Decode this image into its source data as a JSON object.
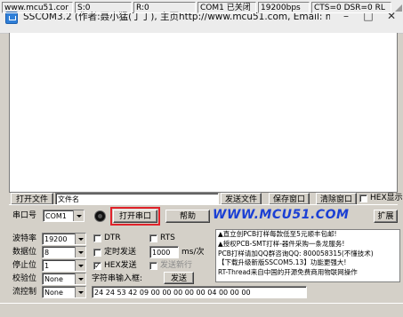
{
  "window": {
    "title": "SSCOM3.2 (作者:聂小猛(丁丁), 主页http://www.mcu51.com,  Email: mc...",
    "minimize_glyph": "–",
    "maximize_glyph": "□",
    "close_glyph": "✕",
    "icon": "app-icon"
  },
  "file_row": {
    "open_file_button": "打开文件",
    "filename_field": "文件名",
    "send_file_button": "发送文件",
    "save_window_button": "保存窗口",
    "clear_window_button": "清除窗口",
    "hex_display_label": "HEX显示",
    "hex_display_checked": false
  },
  "port_row": {
    "port_label": "串口号",
    "port_value": "COM1",
    "open_port_button": "打开串口",
    "help_button": "帮助",
    "logo_text": "WWW.MCU51.COM",
    "expand_button": "扩展"
  },
  "settings": {
    "baud_label": "波特率",
    "baud_value": "19200",
    "databits_label": "数据位",
    "databits_value": "8",
    "stopbits_label": "停止位",
    "stopbits_value": "1",
    "parity_label": "校验位",
    "parity_value": "None",
    "flow_label": "流控制",
    "flow_value": "None"
  },
  "send_options": {
    "dtr_label": "DTR",
    "dtr_checked": false,
    "rts_label": "RTS",
    "rts_checked": false,
    "timed_send_label": "定时发送",
    "timed_send_checked": false,
    "interval_value": "1000",
    "interval_unit": "ms/次",
    "hex_send_label": "HEX发送",
    "hex_send_checked": true,
    "send_newline_label": "发送新行",
    "send_newline_checked": false,
    "input_label": "字符串输入框:",
    "send_button": "发送",
    "send_text": "24 24 53 42 09 00 00 00 00 00 04 00 00 00"
  },
  "ad_lines": [
    "▲直立创PCB打样每款低至5元顺丰包邮!",
    "▲授权PCB-SMT打样-器件采购一条龙服务!",
    "PCB打样请加QQ群咨询QQ: 800058315(不懂技术)",
    "【下载升级新版SSCOM5.13】功能更强大!",
    "RT-Thread来自中国的开源免费商用物联网操作"
  ],
  "status_bar": {
    "site": "www.mcu51.cor",
    "sent": "S:0",
    "received": "R:0",
    "port_status": "COM1 已关闭",
    "baud": "19200bps",
    "signals": "CTS=0 DSR=0 RL"
  },
  "colors": {
    "window_bg": "#d4d0c8",
    "logo_blue": "#1a3fd4",
    "highlight_red": "#e0222a"
  }
}
